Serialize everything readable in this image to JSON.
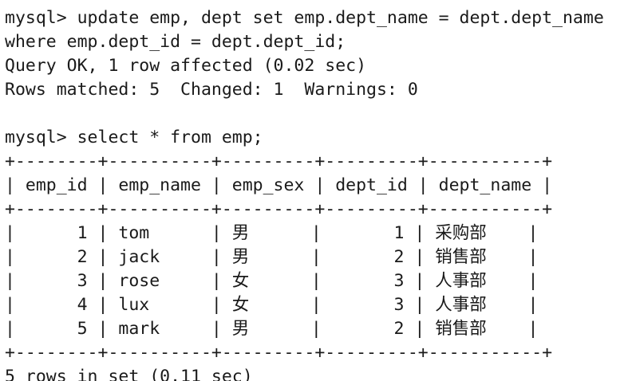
{
  "terminal": {
    "background": "#ffffff",
    "foreground": "#1a1a1a",
    "lines": [
      "mysql> update emp, dept set emp.dept_name = dept.dept_name",
      "where emp.dept_id = dept.dept_id;",
      "Query OK, 1 row affected (0.02 sec)",
      "Rows matched: 5  Changed: 1  Warnings: 0",
      "",
      "mysql> select * from emp;",
      "+--------+----------+---------+---------+-----------+",
      "| emp_id | emp_name | emp_sex | dept_id | dept_name |",
      "+--------+----------+---------+---------+-----------+",
      "|      1 | tom      | 男      |       1 | 采购部    |",
      "|      2 | jack     | 男      |       2 | 销售部    |",
      "|      3 | rose     | 女      |       3 | 人事部    |",
      "|      4 | lux      | 女      |       3 | 人事部    |",
      "|      5 | mark     | 男      |       2 | 销售部    |",
      "+--------+----------+---------+---------+-----------+",
      "5 rows in set (0.11 sec)"
    ]
  }
}
